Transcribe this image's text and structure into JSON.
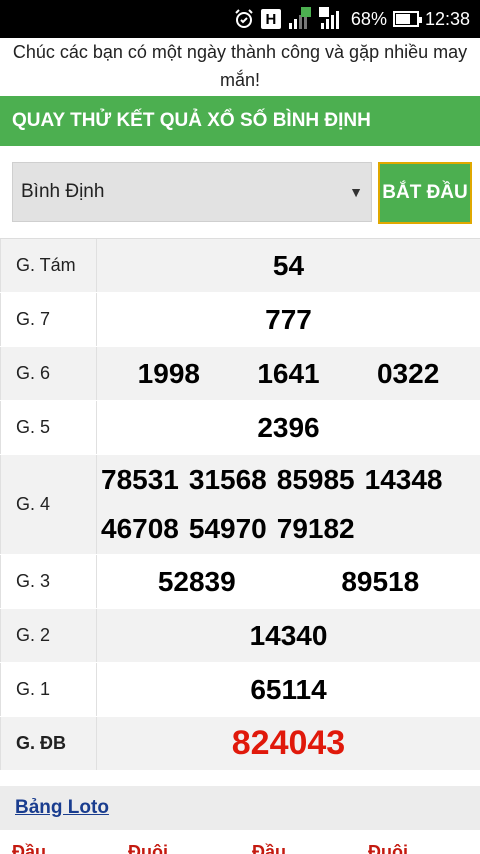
{
  "status": {
    "battery": "68%",
    "time": "12:38",
    "network": "H",
    "sim1": "1",
    "sim2": "2",
    "battery_level": 0.68
  },
  "greeting": "Chúc các bạn có một ngày thành công và gặp nhiều may mắn!",
  "header": {
    "title": "QUAY THỬ KẾT QUẢ XỔ SỐ BÌNH ĐỊNH"
  },
  "selector": {
    "value": "Bình Định",
    "button": "BẮT ĐẦU"
  },
  "results": [
    {
      "label": "G. Tám",
      "numbers": [
        "54"
      ]
    },
    {
      "label": "G. 7",
      "numbers": [
        "777"
      ]
    },
    {
      "label": "G. 6",
      "numbers": [
        "1998",
        "1641",
        "0322"
      ]
    },
    {
      "label": "G. 5",
      "numbers": [
        "2396"
      ]
    },
    {
      "label": "G. 4",
      "numbers": [
        "78531",
        "31568",
        "85985",
        "14348",
        "46708",
        "54970",
        "79182"
      ]
    },
    {
      "label": "G. 3",
      "numbers": [
        "52839",
        "89518"
      ]
    },
    {
      "label": "G. 2",
      "numbers": [
        "14340"
      ]
    },
    {
      "label": "G. 1",
      "numbers": [
        "65114"
      ]
    },
    {
      "label": "G. ĐB",
      "numbers": [
        "824043"
      ]
    }
  ],
  "loto": {
    "link": "Bảng Loto",
    "headers": [
      "Đầu",
      "Đuôi",
      "Đầu",
      "Đuôi"
    ]
  },
  "colors": {
    "green": "#4caf50",
    "special": "#e0190b",
    "link": "#1a3d8f"
  }
}
